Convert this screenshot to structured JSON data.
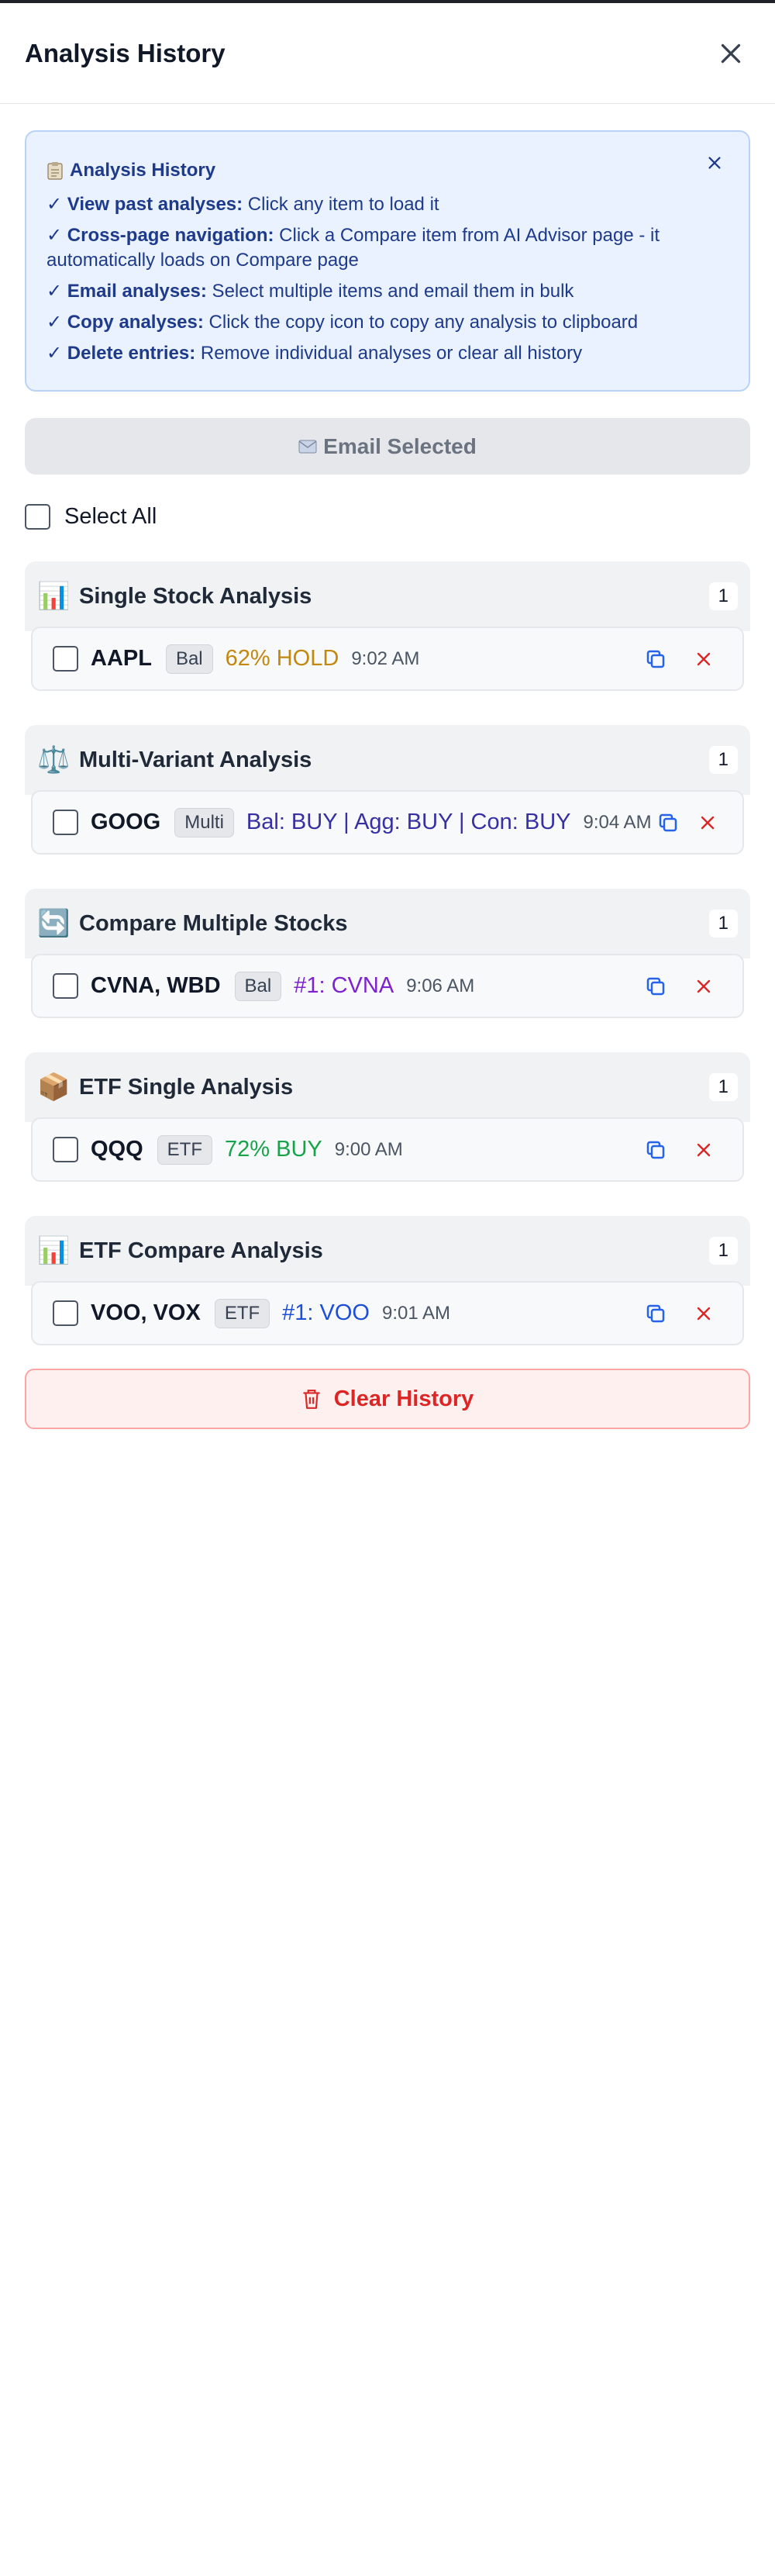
{
  "header": {
    "title": "Analysis History"
  },
  "info": {
    "title": "Analysis History",
    "lines": [
      {
        "bold": "View past analyses:",
        "text": " Click any item to load it"
      },
      {
        "bold": "Cross-page navigation:",
        "text": " Click a Compare item from AI Advisor page - it automatically loads on Compare page"
      },
      {
        "bold": "Email analyses:",
        "text": " Select multiple items and email them in bulk"
      },
      {
        "bold": "Copy analyses:",
        "text": " Click the copy icon to copy any analysis to clipboard"
      },
      {
        "bold": "Delete entries:",
        "text": " Remove individual analyses or clear all history"
      }
    ],
    "check": "✓"
  },
  "email_button": {
    "label": "Email Selected"
  },
  "select_all": {
    "label": "Select All"
  },
  "groups": [
    {
      "emoji": "📊",
      "title": "Single Stock Analysis",
      "count": "1",
      "item": {
        "ticker": "AAPL",
        "tag": "Bal",
        "result": "62% HOLD",
        "result_color": "#c2870e",
        "time": "9:02 AM"
      }
    },
    {
      "emoji": "⚖️",
      "title": "Multi-Variant Analysis",
      "count": "1",
      "item": {
        "ticker": "GOOG",
        "tag": "Multi",
        "result": "Bal: BUY | Agg: BUY | Con: BUY",
        "result_color": "#3730a3",
        "time": "9:04 AM"
      }
    },
    {
      "emoji": "🔄",
      "title": "Compare Multiple Stocks",
      "count": "1",
      "item": {
        "ticker": "CVNA, WBD",
        "tag": "Bal",
        "result": "#1: CVNA",
        "result_color": "#7e22ce",
        "time": "9:06 AM"
      }
    },
    {
      "emoji": "📦",
      "title": "ETF Single Analysis",
      "count": "1",
      "item": {
        "ticker": "QQQ",
        "tag": "ETF",
        "result": "72% BUY",
        "result_color": "#16a34a",
        "time": "9:00 AM"
      }
    },
    {
      "emoji": "📊",
      "title": "ETF Compare Analysis",
      "count": "1",
      "item": {
        "ticker": "VOO, VOX",
        "tag": "ETF",
        "result": "#1: VOO",
        "result_color": "#1d4ed8",
        "time": "9:01 AM"
      }
    }
  ],
  "clear_button": {
    "label": "Clear History"
  },
  "colors": {
    "accent_blue": "#2563eb",
    "danger_red": "#dc2626",
    "info_bg": "#eaf2ff"
  },
  "icons": {
    "close": "close-icon",
    "copy": "copy-icon",
    "delete": "x-icon",
    "trash": "trash-icon",
    "email": "envelope-icon",
    "clipboard": "clipboard-icon"
  }
}
